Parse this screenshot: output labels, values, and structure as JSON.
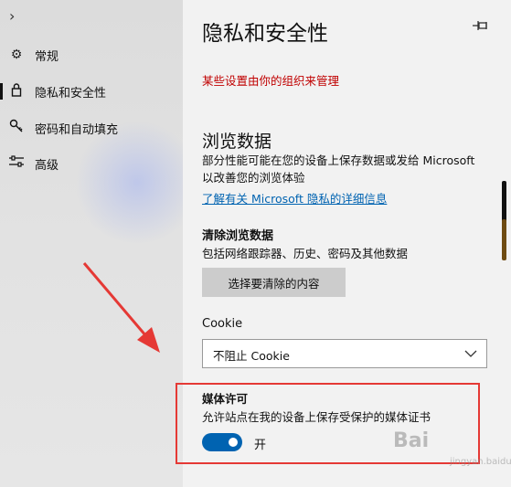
{
  "nav": {
    "expand_glyph": "›",
    "items": [
      {
        "icon": "gear-icon",
        "glyph": "⚙",
        "label": "常规"
      },
      {
        "icon": "lock-icon",
        "glyph": "🔒︎",
        "label": "隐私和安全性"
      },
      {
        "icon": "key-icon",
        "glyph": "⚷",
        "label": "密码和自动填充"
      },
      {
        "icon": "sliders-icon",
        "glyph": "☰",
        "label": "高级"
      }
    ]
  },
  "panel": {
    "title": "隐私和安全性",
    "pin_glyph": "⊸",
    "org_notice": "某些设置由你的组织来管理",
    "browsing_data": {
      "heading": "浏览数据",
      "description": "部分性能可能在您的设备上保存数据或发给 Microsoft 以改善您的浏览体验",
      "link": "了解有关 Microsoft 隐私的详细信息"
    },
    "clear_data": {
      "heading": "清除浏览数据",
      "description": "包括网络跟踪器、历史、密码及其他数据",
      "button": "选择要清除的内容"
    },
    "cookie": {
      "label": "Cookie",
      "selected": "不阻止 Cookie"
    },
    "media": {
      "heading": "媒体许可",
      "description": "允许站点在我的设备上保存受保护的媒体证书",
      "toggle_state": "开",
      "toggle_on": true
    }
  },
  "colors": {
    "accent": "#0063b1",
    "warning": "#c00000",
    "highlight": "#e53935"
  },
  "watermark": {
    "text": "Bai",
    "sub": "jingyan.baidu.com"
  }
}
